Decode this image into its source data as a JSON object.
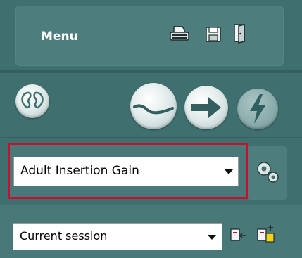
{
  "menu": {
    "label": "Menu",
    "icons": [
      "print-icon",
      "save-icon",
      "exit-door-icon"
    ]
  },
  "toolbar": {
    "buttons": [
      "ear-icon",
      "hearing-aid-curve-icon",
      "next-arrow-icon",
      "lightning-icon"
    ]
  },
  "target_select": {
    "value": "Adult Insertion Gain",
    "highlight_color": "#c8102e"
  },
  "session_select": {
    "value": "Current session"
  },
  "side_icons": [
    "settings-gears-icon",
    "import-session-icon",
    "new-session-icon"
  ]
}
